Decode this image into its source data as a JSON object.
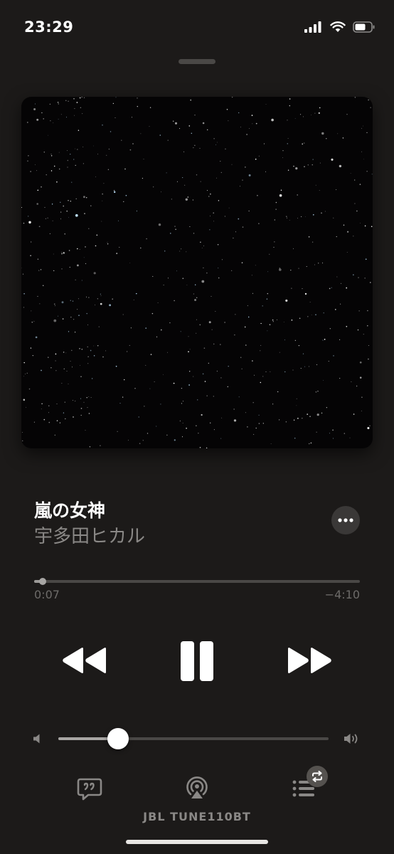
{
  "status_bar": {
    "time": "23:29"
  },
  "track": {
    "title": "嵐の女神",
    "artist": "宇多田ヒカル"
  },
  "playback": {
    "elapsed": "0:07",
    "remaining": "−4:10",
    "progress_fraction": 0.027,
    "state": "playing"
  },
  "volume": {
    "level_fraction": 0.22
  },
  "output": {
    "device_name": "JBL TUNE110BT"
  },
  "icons": {
    "more": "ellipsis-icon",
    "rewind": "rewind-icon",
    "pause": "pause-icon",
    "forward": "fast-forward-icon",
    "lyrics": "lyrics-icon",
    "airplay": "airplay-icon",
    "queue": "queue-icon",
    "repeat": "repeat-icon"
  },
  "colors": {
    "background": "#1c1a19",
    "secondary_text": "#8a8886",
    "artwork_bg": "#050405"
  }
}
